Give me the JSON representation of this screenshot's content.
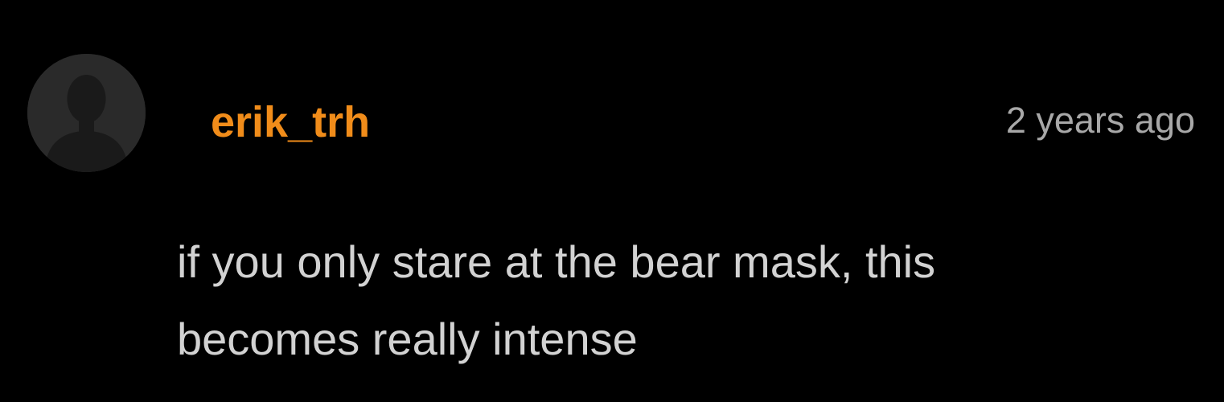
{
  "comment": {
    "avatar_icon": "user-silhouette-icon",
    "username": "erik_trh",
    "timestamp": "2 years ago",
    "text": "if you only stare at the bear mask, this becomes really intense"
  },
  "colors": {
    "background": "#000000",
    "username": "#f08c1a",
    "timestamp": "#a8a8a8",
    "text": "#d2d2d2",
    "avatar_bg": "#2a2a2a",
    "avatar_figure": "#1a1a1a"
  }
}
